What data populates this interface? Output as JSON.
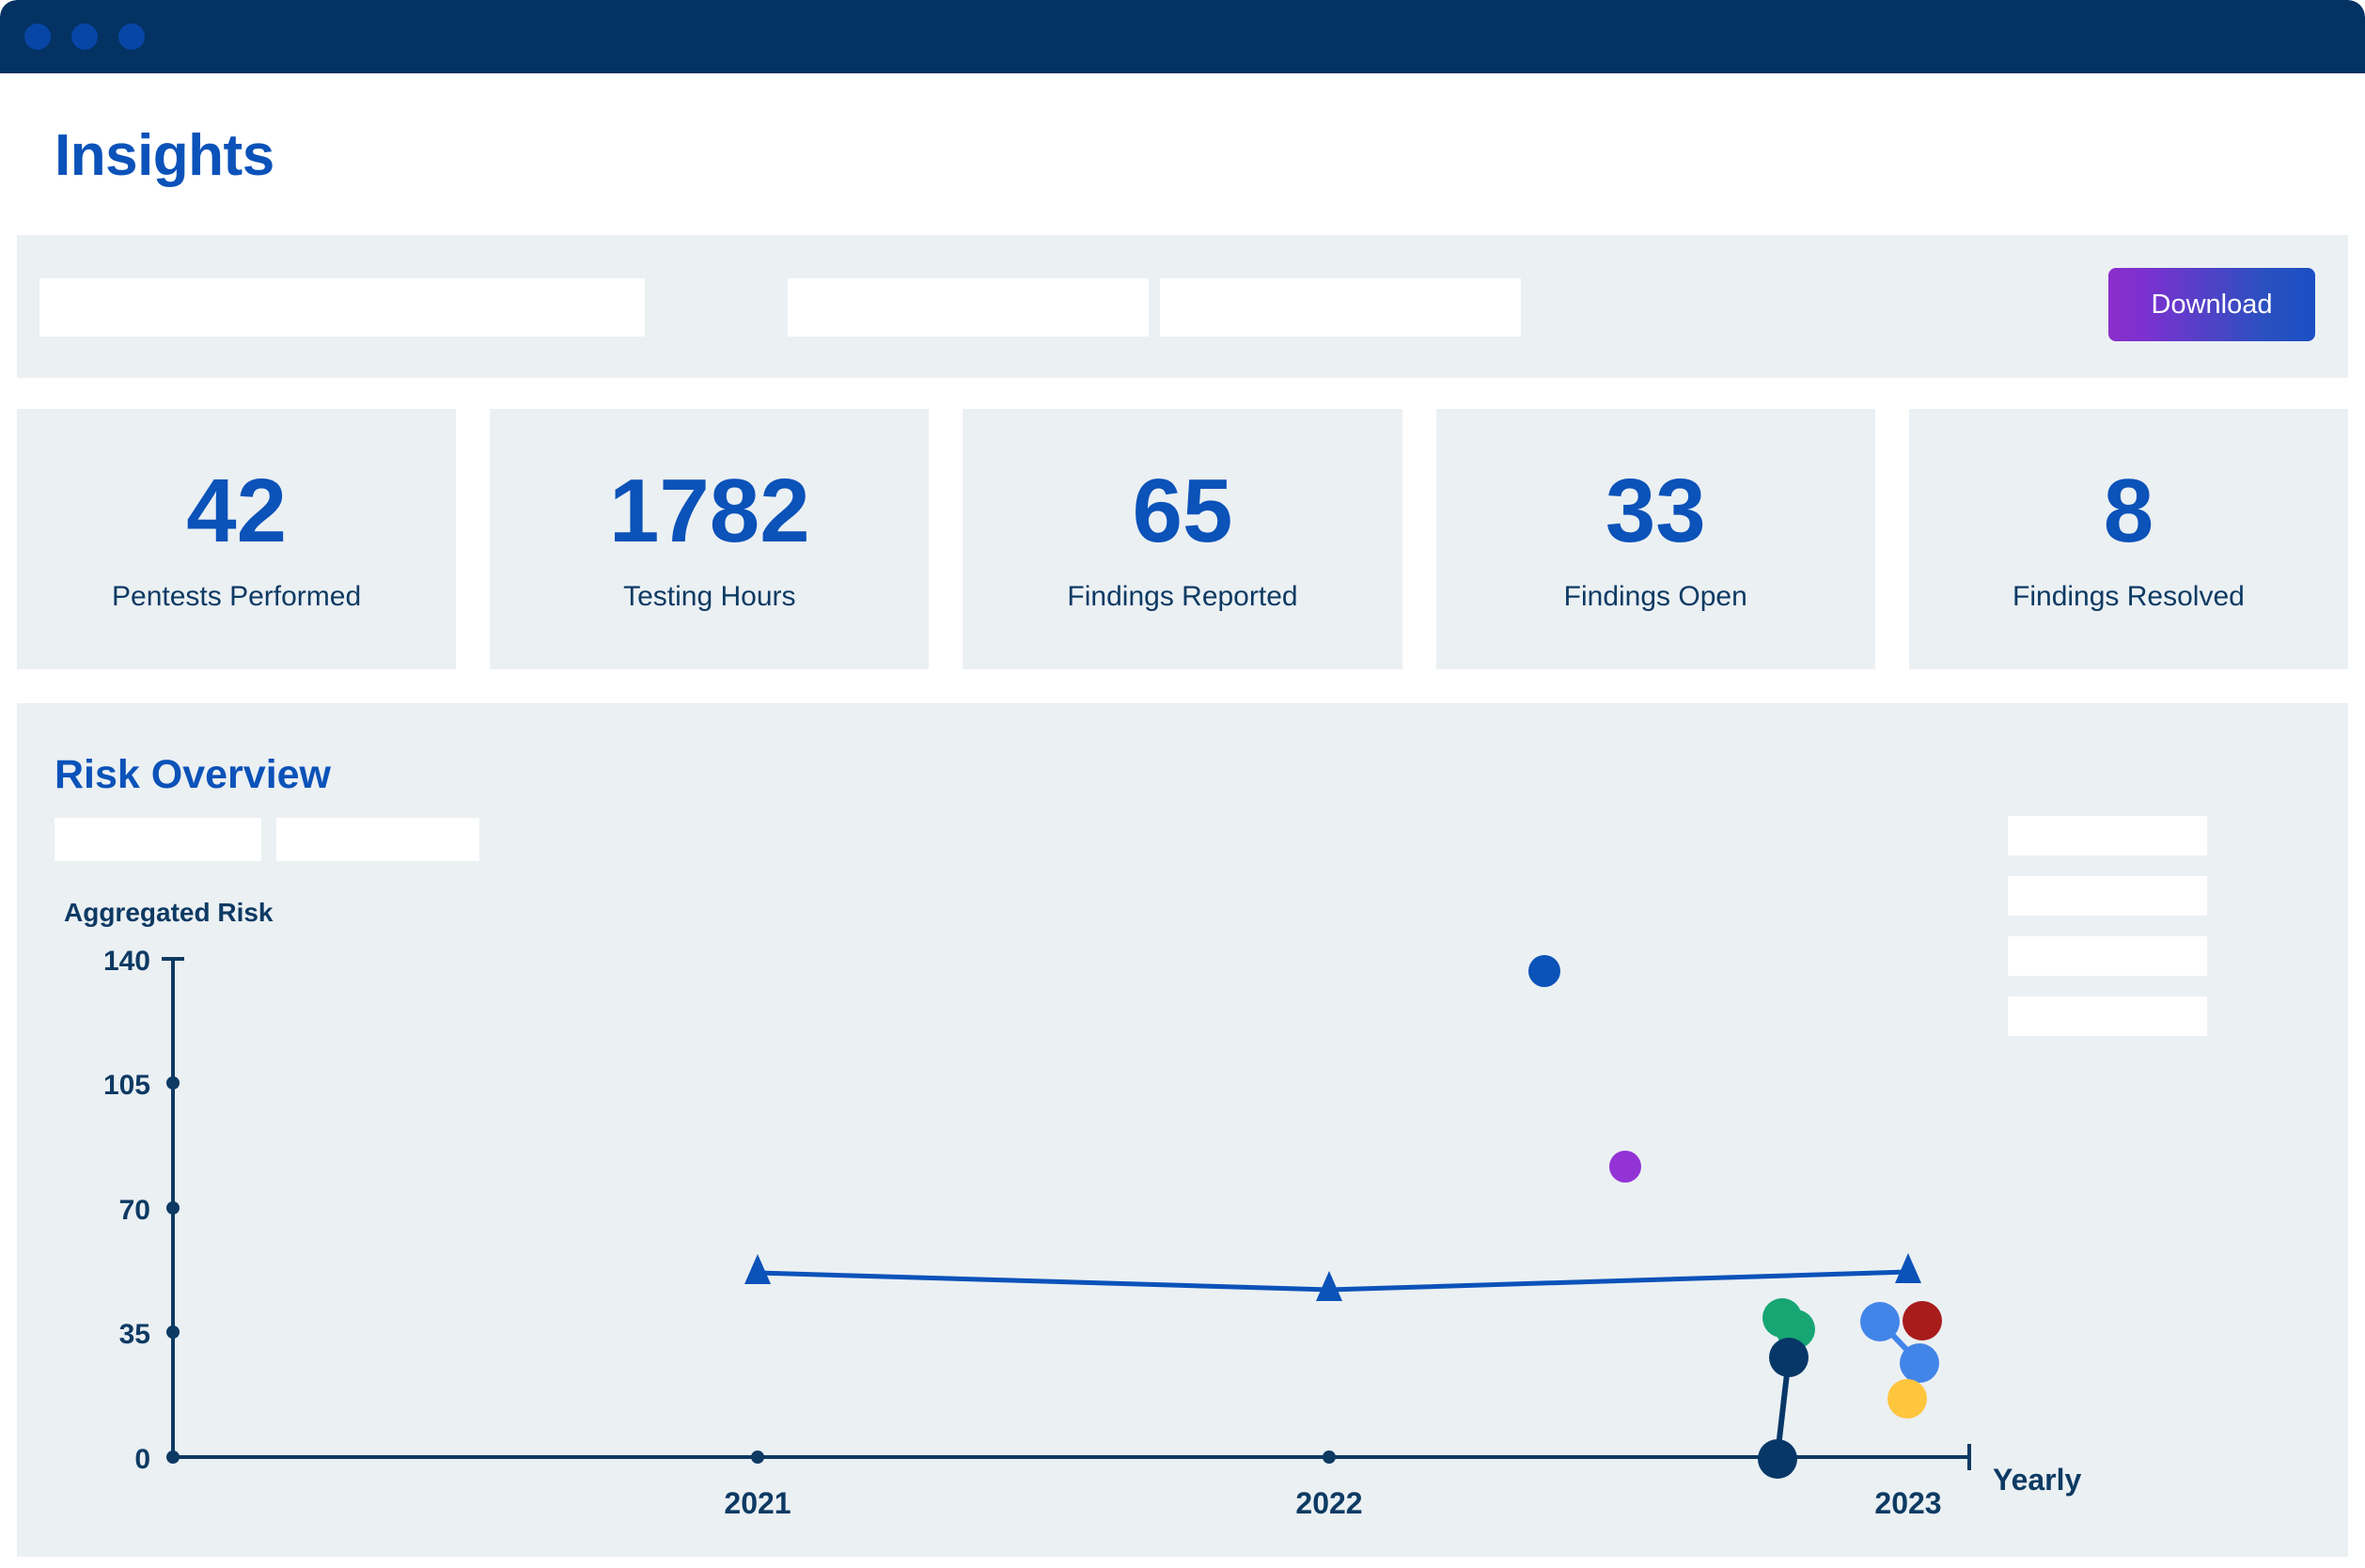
{
  "window": {
    "chrome_dots": [
      "dot-1",
      "dot-2",
      "dot-3"
    ],
    "chrome_color": "#033263",
    "dot_color": "#0746a5"
  },
  "header": {
    "title": "Insights",
    "title_color": "#0b52b9"
  },
  "toolbar": {
    "filters": [
      {
        "name": "filter-primary",
        "value": "",
        "placeholder": ""
      },
      {
        "name": "filter-secondary",
        "value": "",
        "placeholder": ""
      },
      {
        "name": "filter-tertiary",
        "value": "",
        "placeholder": ""
      }
    ],
    "download_label": "Download",
    "download_gradient_from": "#8b2ecb",
    "download_gradient_to": "#1a4fc4"
  },
  "stats": [
    {
      "value": "42",
      "label": "Pentests Performed"
    },
    {
      "value": "1782",
      "label": "Testing Hours"
    },
    {
      "value": "65",
      "label": "Findings Reported"
    },
    {
      "value": "33",
      "label": "Findings Open"
    },
    {
      "value": "8",
      "label": "Findings Resolved"
    }
  ],
  "risk": {
    "title": "Risk Overview",
    "filters": [
      {
        "name": "risk-filter-one",
        "value": ""
      },
      {
        "name": "risk-filter-two",
        "value": ""
      }
    ],
    "legend_placeholders": 4
  },
  "chart_data": {
    "type": "scatter",
    "title": "Risk Overview",
    "ylabel": "Aggregated Risk",
    "xlabel": "Yearly",
    "categories": [
      "2021",
      "2022",
      "2023"
    ],
    "yticks": [
      0,
      35,
      70,
      105,
      140
    ],
    "ylim": [
      0,
      140
    ],
    "grid": false,
    "legend_position": "right",
    "series": [
      {
        "name": "aggregated-risk-trend",
        "type": "line",
        "marker": "triangle",
        "color": "#0b52b9",
        "x": [
          "2021",
          "2022",
          "2023"
        ],
        "values": [
          52,
          47,
          52
        ]
      },
      {
        "name": "scatter-dark-blue",
        "type": "scatter",
        "marker": "circle",
        "color": "#0b52b9",
        "points": [
          {
            "x": 2022.38,
            "y": 138
          }
        ]
      },
      {
        "name": "scatter-purple",
        "type": "scatter",
        "marker": "circle",
        "color": "#9333d6",
        "points": [
          {
            "x": 2022.62,
            "y": 82
          }
        ]
      },
      {
        "name": "scatter-green",
        "type": "scatter",
        "marker": "circle",
        "color": "#17a673",
        "points": [
          {
            "x": 2022.78,
            "y": 23
          },
          {
            "x": 2022.81,
            "y": 20
          }
        ]
      },
      {
        "name": "scatter-navy",
        "type": "scatter",
        "marker": "circle",
        "color": "#063767",
        "points": [
          {
            "x": 2022.79,
            "y": 14
          },
          {
            "x": 2022.78,
            "y": -1
          }
        ]
      },
      {
        "name": "scatter-light-blue",
        "type": "scatter",
        "marker": "circle",
        "color": "#4285e8",
        "points": [
          {
            "x": 2022.96,
            "y": 22
          },
          {
            "x": 2023.02,
            "y": 10
          }
        ]
      },
      {
        "name": "scatter-red",
        "type": "scatter",
        "marker": "circle",
        "color": "#a81c1c",
        "points": [
          {
            "x": 2023.02,
            "y": 22
          }
        ]
      },
      {
        "name": "scatter-yellow",
        "type": "scatter",
        "marker": "circle",
        "color": "#ffc53d",
        "points": [
          {
            "x": 2022.99,
            "y": 4
          }
        ]
      }
    ]
  }
}
